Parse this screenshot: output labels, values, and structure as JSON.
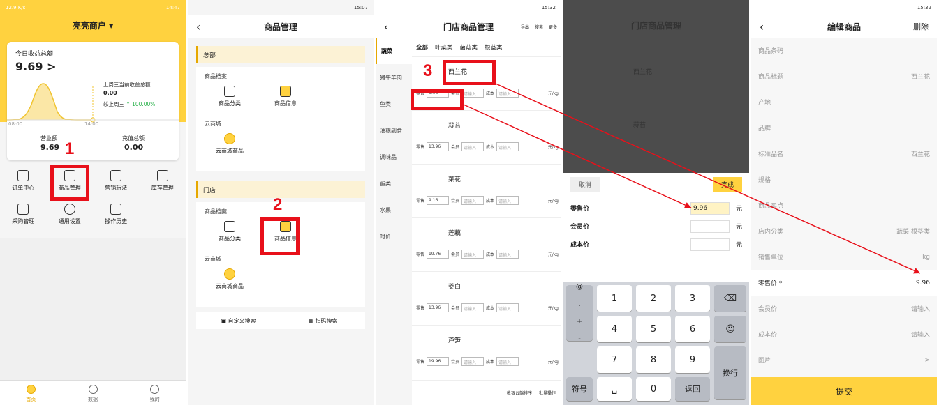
{
  "panel1": {
    "status_left": "12.9 K/s",
    "status_right": "14:47",
    "store_name": "亮亮商户 ▾",
    "today_label": "今日收益总额",
    "today_value": "9.69 >",
    "lastweek_label": "上周三当前收益总额",
    "lastweek_value": "0.00",
    "compare": "较上周三",
    "compare_pct": "↑ 100.00%",
    "time_a": "08:00",
    "time_b": "14:00",
    "revenue_label": "营业额",
    "revenue_value": "9.69",
    "recharge_label": "充值总额",
    "recharge_value": "0.00",
    "grid": [
      {
        "label": "订单中心",
        "icon": "clipboard-icon"
      },
      {
        "label": "商品管理",
        "icon": "box-icon"
      },
      {
        "label": "营销玩法",
        "icon": "gift-icon"
      },
      {
        "label": "库存管理",
        "icon": "warehouse-icon"
      },
      {
        "label": "采购管理",
        "icon": "basket-icon"
      },
      {
        "label": "通用设置",
        "icon": "gear-icon"
      },
      {
        "label": "操作历史",
        "icon": "history-icon"
      }
    ],
    "tabs": [
      {
        "label": "首页",
        "icon": "home-icon"
      },
      {
        "label": "数据",
        "icon": "pie-icon"
      },
      {
        "label": "我的",
        "icon": "user-icon"
      }
    ]
  },
  "panel2": {
    "status_right": "15:07",
    "title": "商品管理",
    "hq": "总部",
    "archive": "商品档案",
    "cat": "商品分类",
    "info": "商品信息",
    "cloud": "云商城",
    "cloud_goods": "云商城商品",
    "store": "门店",
    "custom_search": "自定义搜索",
    "scan_search": "扫码搜索"
  },
  "panel3": {
    "status_right": "15:32",
    "title": "门店商品管理",
    "actions": [
      "导出",
      "搜索",
      "更多"
    ],
    "side": [
      "蔬菜",
      "猪牛羊肉",
      "鱼类",
      "油粮副食",
      "调味品",
      "蛋类",
      "水果",
      "时价"
    ],
    "cats": [
      "全部",
      "叶菜类",
      "菌菇类",
      "根茎类"
    ],
    "labels": {
      "retail": "零售",
      "member": "会员",
      "cost": "成本",
      "unit": "元/kg",
      "placeholder": "请输入"
    },
    "items": [
      {
        "name": "西兰花",
        "price": "9.96"
      },
      {
        "name": "蒜苔",
        "price": "13.96"
      },
      {
        "name": "菜花",
        "price": "9.16"
      },
      {
        "name": "莲藕",
        "price": "19.76"
      },
      {
        "name": "茭白",
        "price": "13.96"
      },
      {
        "name": "芦笋",
        "price": "19.96"
      }
    ],
    "bottom": [
      "收银台端排序",
      "批量操作"
    ]
  },
  "panel4": {
    "cancel": "取消",
    "done": "完成",
    "retail": "零售价",
    "member": "会员价",
    "cost": "成本价",
    "retail_value": "9.96",
    "unit": "元",
    "keys": [
      "1",
      "2",
      "3",
      "4",
      "5",
      "6",
      "7",
      "8",
      "9",
      "0"
    ],
    "side_keys": [
      "@",
      ".",
      "+",
      "-"
    ],
    "sym": "符号",
    "ret": "返回",
    "enter": "换行"
  },
  "panel5": {
    "status_right": "15:32",
    "title": "编辑商品",
    "delete": "删除",
    "rows": [
      {
        "label": "商品条码",
        "value": ""
      },
      {
        "label": "商品标题",
        "value": "西兰花"
      },
      {
        "label": "产地",
        "value": ""
      },
      {
        "label": "品牌",
        "value": ""
      },
      {
        "label": "标准品名",
        "value": "西兰花"
      },
      {
        "label": "规格",
        "value": ""
      },
      {
        "label": "商品卖点",
        "value": ""
      },
      {
        "label": "店内分类",
        "value": "蔬菜 根茎类"
      },
      {
        "label": "销售单位",
        "value": "kg"
      },
      {
        "label": "零售价 *",
        "value": "9.96"
      },
      {
        "label": "会员价",
        "value": "请输入"
      },
      {
        "label": "成本价",
        "value": "请输入"
      },
      {
        "label": "图片",
        "value": ">"
      }
    ],
    "submit": "提交"
  },
  "annotations": [
    "1",
    "2",
    "3"
  ]
}
